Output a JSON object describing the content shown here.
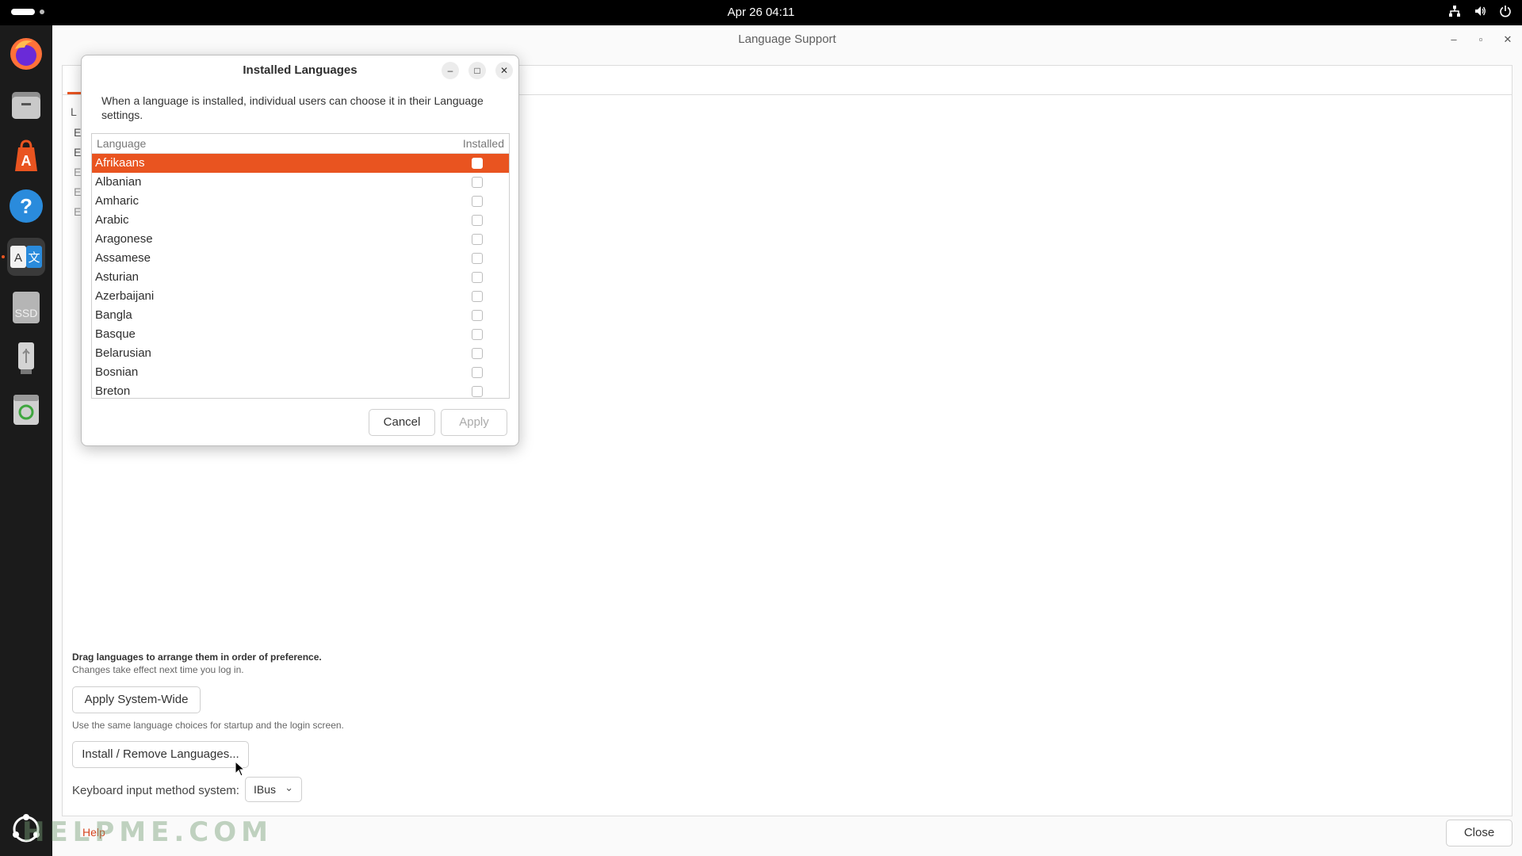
{
  "topbar": {
    "clock": "Apr 26  04:11",
    "tray_icons": [
      "network-icon",
      "volume-icon",
      "power-icon"
    ]
  },
  "dock": {
    "items": [
      "firefox-icon",
      "files-icon",
      "app-center-icon",
      "help-icon",
      "language-support-icon",
      "ssd-drive-icon",
      "usb-drive-icon",
      "trash-icon"
    ],
    "ssd_label": "SSD"
  },
  "main_window": {
    "title": "Language Support",
    "drag_hint": "Drag languages to arrange them in order of preference.",
    "drag_note": "Changes take effect next time you log in.",
    "apply_system_wide": "Apply System-Wide",
    "apply_note": "Use the same language choices for startup and the login screen.",
    "install_remove": "Install / Remove Languages...",
    "keyboard_label": "Keyboard input method system:",
    "keyboard_value": "IBus",
    "help": "Help",
    "close": "Close"
  },
  "dialog": {
    "title": "Installed Languages",
    "description": "When a language is installed, individual users can choose it in their Language settings.",
    "column_language": "Language",
    "column_installed": "Installed",
    "languages": [
      {
        "name": "Afrikaans",
        "installed": false,
        "selected": true
      },
      {
        "name": "Albanian",
        "installed": false
      },
      {
        "name": "Amharic",
        "installed": false
      },
      {
        "name": "Arabic",
        "installed": false
      },
      {
        "name": "Aragonese",
        "installed": false
      },
      {
        "name": "Assamese",
        "installed": false
      },
      {
        "name": "Asturian",
        "installed": false
      },
      {
        "name": "Azerbaijani",
        "installed": false
      },
      {
        "name": "Bangla",
        "installed": false
      },
      {
        "name": "Basque",
        "installed": false
      },
      {
        "name": "Belarusian",
        "installed": false
      },
      {
        "name": "Bosnian",
        "installed": false
      },
      {
        "name": "Breton",
        "installed": false
      }
    ],
    "cancel": "Cancel",
    "apply": "Apply"
  },
  "watermark": "HELPME.COM",
  "colors": {
    "accent": "#e95420",
    "topbar": "#000000",
    "dock": "#1b1b1b"
  }
}
